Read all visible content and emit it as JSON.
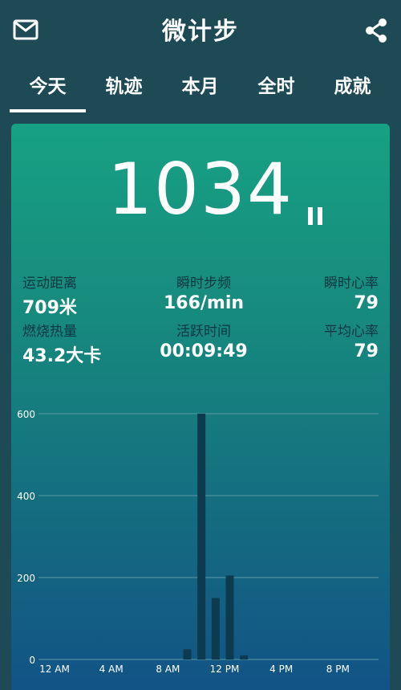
{
  "header": {
    "title": "微计步",
    "mail_icon": "mail-icon",
    "share_icon": "share-icon"
  },
  "tabs": [
    {
      "label": "今天",
      "active": true
    },
    {
      "label": "轨迹",
      "active": false
    },
    {
      "label": "本月",
      "active": false
    },
    {
      "label": "全时",
      "active": false
    },
    {
      "label": "成就",
      "active": false
    }
  ],
  "summary": {
    "steps": "1034",
    "pause_icon": "pause-icon"
  },
  "stats": {
    "distance": {
      "label": "运动距离",
      "value": "709米"
    },
    "cadence": {
      "label": "瞬时步频",
      "value": "166/min"
    },
    "heart_rate_now": {
      "label": "瞬时心率",
      "value": "79"
    },
    "calories": {
      "label": "燃烧热量",
      "value": "43.2大卡"
    },
    "active_time": {
      "label": "活跃时间",
      "value": "00:09:49"
    },
    "heart_rate_avg": {
      "label": "平均心率",
      "value": "79"
    }
  },
  "colors": {
    "card_top": "#17a183",
    "card_bottom": "#125386",
    "bar": "#0e3a50",
    "grid": "#5d9aa6"
  },
  "chart_data": {
    "type": "bar",
    "x_unit": "hour",
    "x": [
      10,
      11,
      12,
      13,
      14
    ],
    "values": [
      25,
      600,
      150,
      205,
      10
    ],
    "xticks": [
      "12 AM",
      "4 AM",
      "8 AM",
      "12 PM",
      "4 PM",
      "8 PM"
    ],
    "yticks": [
      "0",
      "200",
      "400",
      "600"
    ],
    "ylim": [
      0,
      600
    ],
    "xlim": [
      0,
      24
    ],
    "grid": true
  }
}
